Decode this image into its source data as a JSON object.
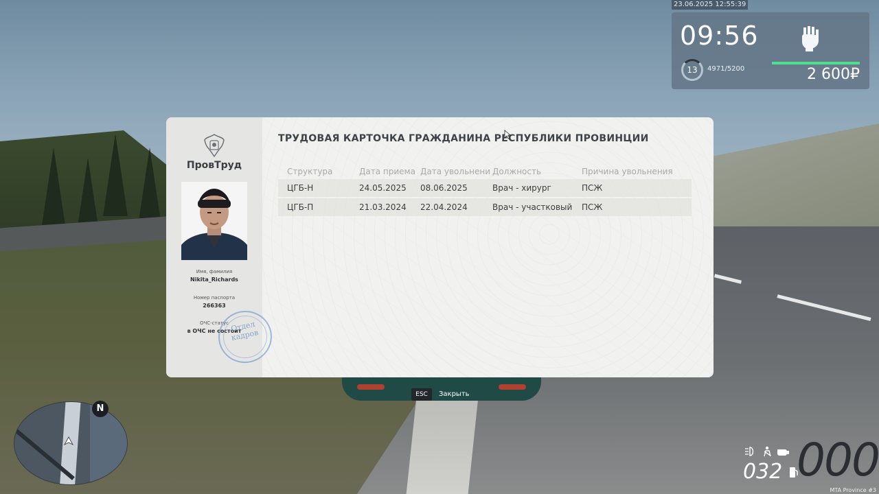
{
  "hud": {
    "datetime": "23.06.2025 12:55:39",
    "clock": "09:56",
    "level": "13",
    "experience": "4971/5200",
    "money": "2 600₽",
    "health_color": "#4ee08e"
  },
  "card": {
    "org_name": "ПровТруд",
    "title": "ТРУДОВАЯ КАРТОЧКА ГРАЖДАНИНА РЕСПУБЛИКИ ПРОВИНЦИИ",
    "name_label": "Имя, фамилия",
    "name_value": "Nikita_Richards",
    "passport_label": "Номер паспорта",
    "passport_value": "266363",
    "ochs_label": "ОЧС-статус",
    "ochs_value": "в ОЧС не состоит",
    "stamp_line1": "Отдел",
    "stamp_line2": "кадров",
    "columns": [
      "Структура",
      "Дата приема",
      "Дата увольнени",
      "Должность",
      "Причина увольнения"
    ],
    "rows": [
      [
        "ЦГБ-Н",
        "24.05.2025",
        "08.06.2025",
        "Врач - хирург",
        "ПСЖ"
      ],
      [
        "ЦГБ-П",
        "21.03.2024",
        "22.04.2024",
        "Врач - участковый",
        "ПСЖ"
      ]
    ]
  },
  "footer": {
    "esc_key": "ESC",
    "esc_label": "Закрыть",
    "compass": "N",
    "speed": "000",
    "gear_fuel": "032",
    "server_tag": "MTA Province #3"
  },
  "icons": [
    "fist-icon",
    "emblem-icon",
    "player-arrow-icon",
    "headlight-icon",
    "seatbelt-icon",
    "engine-icon",
    "fuel-icon",
    "cursor-icon"
  ]
}
